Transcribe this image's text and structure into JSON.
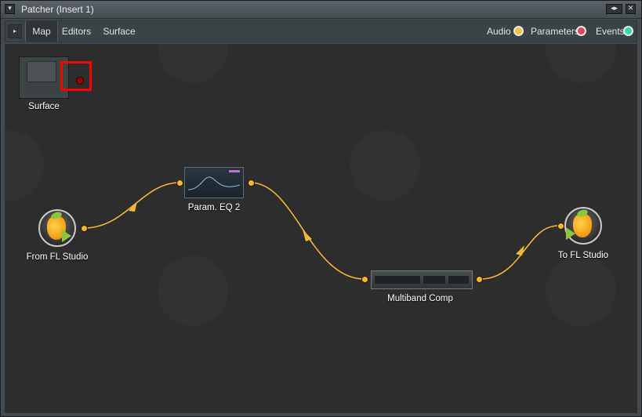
{
  "window": {
    "title": "Patcher (Insert 1)"
  },
  "titlebar": {
    "menu_glyph": "▾",
    "detach_glyph": "◂▸",
    "close_glyph": "✕"
  },
  "tabs": [
    {
      "label": "Map",
      "active": true
    },
    {
      "label": "Editors",
      "active": false
    },
    {
      "label": "Surface",
      "active": false
    }
  ],
  "tabbar": {
    "expand_glyph": "▸"
  },
  "legend": [
    {
      "label": "Audio",
      "color": "#f3c23b"
    },
    {
      "label": "Parameters",
      "color": "#e2485b"
    },
    {
      "label": "Events",
      "color": "#39d9a7"
    }
  ],
  "nodes": {
    "surface": {
      "label": "Surface",
      "icon": "surface-thumbnail"
    },
    "from_fl": {
      "label": "From FL Studio",
      "icon": "fl-studio-logo"
    },
    "eq": {
      "label": "Param. EQ 2",
      "icon": "param-eq-thumbnail"
    },
    "comp": {
      "label": "Multiband Comp",
      "icon": "multiband-comp-thumbnail"
    },
    "to_fl": {
      "label": "To FL Studio",
      "icon": "fl-studio-logo"
    }
  },
  "colors": {
    "cable": "#f3b733",
    "highlight": "#ff0000",
    "canvas": "#2d2d2d"
  }
}
